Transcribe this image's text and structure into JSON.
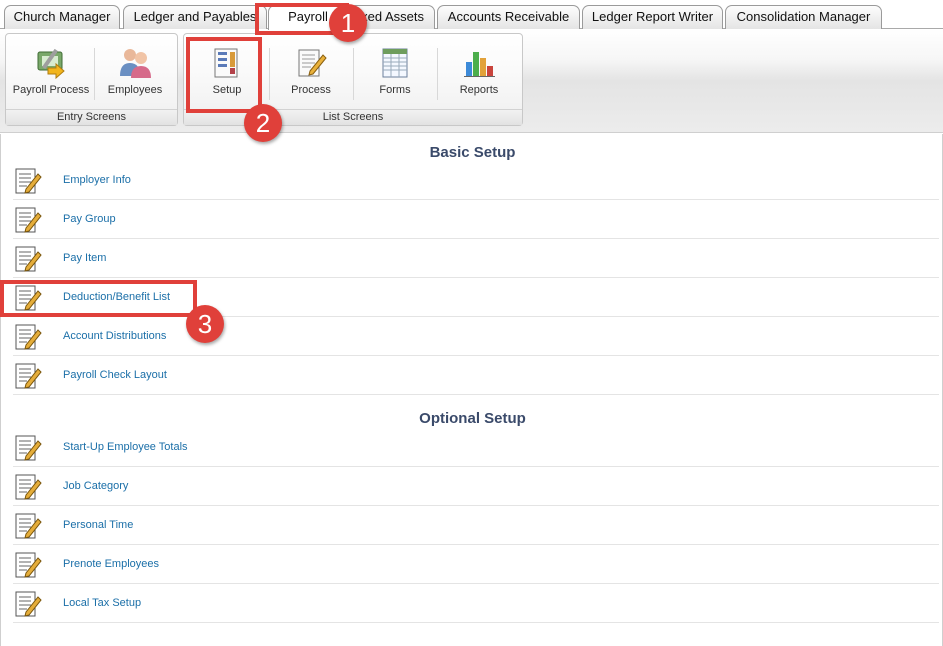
{
  "tabs": [
    {
      "label": "Church Manager"
    },
    {
      "label": "Ledger and Payables"
    },
    {
      "label": "Payroll"
    },
    {
      "label": "Fixed Assets"
    },
    {
      "label": "Accounts Receivable"
    },
    {
      "label": "Ledger Report Writer"
    },
    {
      "label": "Consolidation Manager"
    }
  ],
  "ribbon": {
    "entry_group": {
      "caption": "Entry Screens",
      "buttons": [
        {
          "label": "Payroll Process",
          "icon": "payroll-process-icon"
        },
        {
          "label": "Employees",
          "icon": "employees-icon"
        }
      ]
    },
    "list_group": {
      "caption": "List Screens",
      "buttons": [
        {
          "label": "Setup",
          "icon": "setup-icon"
        },
        {
          "label": "Process",
          "icon": "process-icon"
        },
        {
          "label": "Forms",
          "icon": "forms-icon"
        },
        {
          "label": "Reports",
          "icon": "reports-icon"
        }
      ]
    }
  },
  "basic_setup": {
    "title": "Basic Setup",
    "items": [
      {
        "label": "Employer Info"
      },
      {
        "label": "Pay Group"
      },
      {
        "label": "Pay Item"
      },
      {
        "label": "Deduction/Benefit List"
      },
      {
        "label": "Account Distributions"
      },
      {
        "label": "Payroll Check Layout"
      }
    ]
  },
  "optional_setup": {
    "title": "Optional Setup",
    "items": [
      {
        "label": "Start-Up Employee Totals"
      },
      {
        "label": "Job Category"
      },
      {
        "label": "Personal Time"
      },
      {
        "label": "Prenote Employees"
      },
      {
        "label": "Local Tax Setup"
      }
    ]
  },
  "callouts": [
    {
      "number": "1"
    },
    {
      "number": "2"
    },
    {
      "number": "3"
    }
  ],
  "colors": {
    "link": "#1b6fa8",
    "heading": "#3a4a6a",
    "callout": "#e0403a"
  }
}
